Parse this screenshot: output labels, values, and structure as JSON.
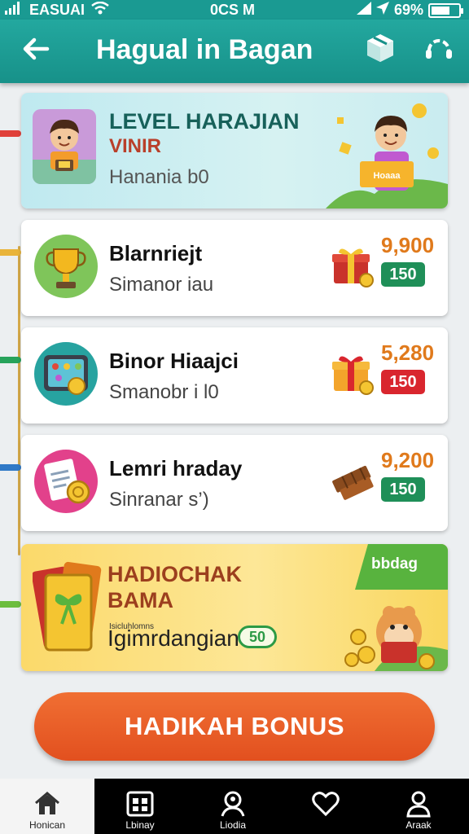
{
  "status": {
    "carrier": "EASUAI",
    "time": "0CS M",
    "battery": "69%",
    "battery_level": 0.69
  },
  "header": {
    "title": "Hagual in Bagan"
  },
  "hero": {
    "title": "LEVEL HARAJIAN",
    "subtitle": "VINIR",
    "meta": "Hanania b0",
    "sign_text": "Hoaaa"
  },
  "items": [
    {
      "title": "Blarnriejt",
      "subtitle": "Simanor iau",
      "points": "9,900",
      "badge": "150",
      "badge_color": "#1f8f58"
    },
    {
      "title": "Binor Hiaajci",
      "subtitle": "Smanobr i l0",
      "points": "5,280",
      "badge": "150",
      "badge_color": "#d9262e"
    },
    {
      "title": "Lemri hraday",
      "subtitle": "Sinranar s’)",
      "points": "9,200",
      "badge": "150",
      "badge_color": "#1f8f58"
    }
  ],
  "promo": {
    "title1": "HADIOCHAK",
    "title2": "BAMA",
    "small": "Isicluhlomns",
    "big": "Igimrdangiane",
    "pill": "50",
    "tag": "bbdag"
  },
  "bonus_button": "HADIKAH BONUS",
  "nav": [
    {
      "label": "Honican",
      "active": true
    },
    {
      "label": "Lbinay",
      "active": false
    },
    {
      "label": "Liodia",
      "active": false
    },
    {
      "label": "",
      "active": false
    },
    {
      "label": "Araak",
      "active": false
    }
  ],
  "colors": {
    "header": "#1a9a92",
    "accent": "#e2501f",
    "points": "#e07a1c",
    "promo_tag": "#58b33e"
  }
}
